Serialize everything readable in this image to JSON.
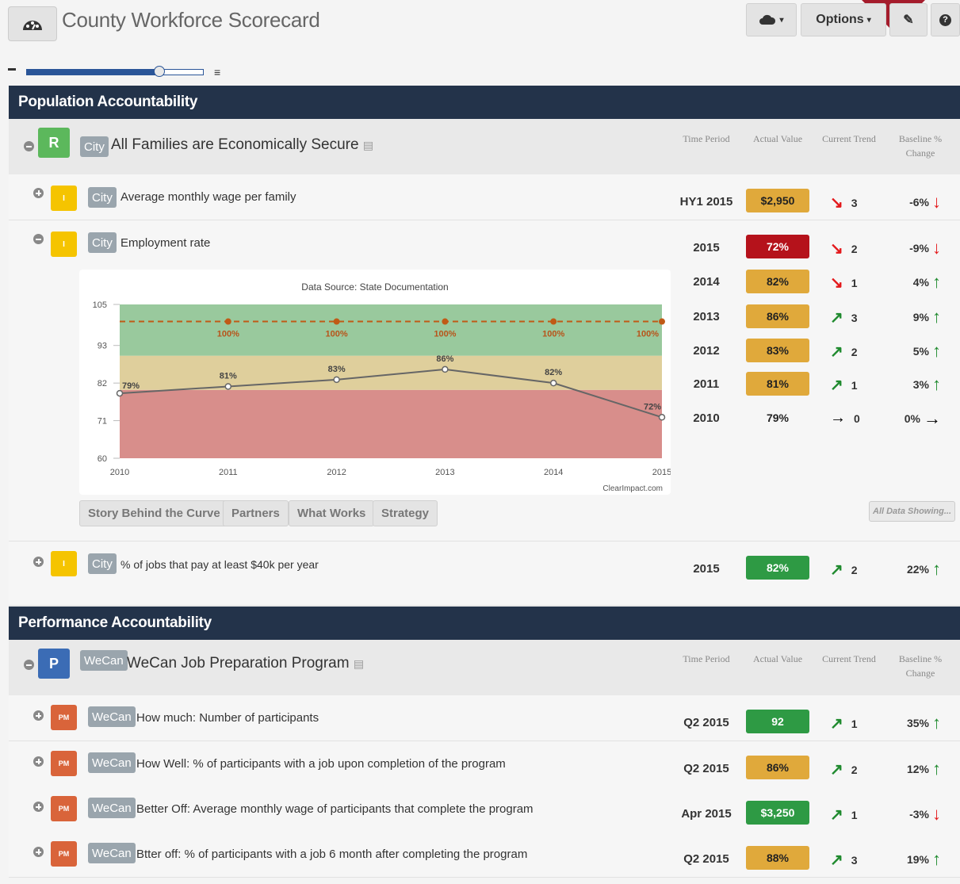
{
  "app": {
    "title": "County Workforce Scorecard",
    "options_label": "Options"
  },
  "sections": [
    {
      "title": "Population Accountability"
    },
    {
      "title": "Performance Accountability"
    }
  ],
  "columns": {
    "time": "Time Period",
    "actual": "Actual Value",
    "trend": "Current Trend",
    "baseline": "Baseline % Change"
  },
  "group1": {
    "badge": "R",
    "scope": "City",
    "title": "All Families are Economically Secure",
    "badge_color": "#5cb85c"
  },
  "rows1": [
    {
      "badge": "I",
      "scope": "City",
      "title": "Average monthly wage per family",
      "period": "HY1 2015",
      "value": "$2,950",
      "trend": "3",
      "baseline": "-6%"
    },
    {
      "badge": "I",
      "scope": "City",
      "title": "Employment rate",
      "period": "2015",
      "value": "72%",
      "trend": "2",
      "baseline": "-9%"
    },
    {
      "badge": "I",
      "scope": "City",
      "title": "% of jobs that pay at least $40k per year",
      "period": "2015",
      "value": "82%",
      "trend": "2",
      "baseline": "22%"
    }
  ],
  "history": [
    {
      "period": "2014",
      "value": "82%",
      "trend": "1",
      "baseline": "4%"
    },
    {
      "period": "2013",
      "value": "86%",
      "trend": "3",
      "baseline": "9%"
    },
    {
      "period": "2012",
      "value": "83%",
      "trend": "2",
      "baseline": "5%"
    },
    {
      "period": "2011",
      "value": "81%",
      "trend": "1",
      "baseline": "3%"
    },
    {
      "period": "2010",
      "value": "79%",
      "trend": "0",
      "baseline": "0%"
    }
  ],
  "chart_tabs": [
    "Story Behind the Curve",
    "Partners",
    "What Works",
    "Strategy"
  ],
  "all_data_label": "All Data Showing...",
  "chart_data": {
    "type": "line",
    "title": "Data Source: State Documentation",
    "credit": "ClearImpact.com",
    "x": [
      "2010",
      "2011",
      "2012",
      "2013",
      "2014",
      "2015"
    ],
    "series": [
      {
        "name": "",
        "values": [
          79,
          81,
          83,
          86,
          82,
          72
        ],
        "labels": [
          "79%",
          "81%",
          "83%",
          "86%",
          "82%",
          "72%"
        ]
      },
      {
        "name": "",
        "values": [
          null,
          100,
          100,
          100,
          100,
          100
        ],
        "labels": [
          "",
          "100%",
          "100%",
          "100%",
          "100%",
          "100%"
        ]
      }
    ],
    "yticks": [
      "105",
      "93",
      "82",
      "71",
      "60"
    ],
    "ylim": [
      60,
      105
    ],
    "bands": [
      {
        "from": 60,
        "to": 80,
        "color": "#d88e8b"
      },
      {
        "from": 80,
        "to": 90,
        "color": "#dfcf9c"
      },
      {
        "from": 90,
        "to": 105,
        "color": "#99c99d"
      }
    ],
    "grid": false
  },
  "group2": {
    "badge": "P",
    "scope": "WeCan",
    "title": "WeCan Job Preparation Program",
    "badge_color": "#3b6cb5"
  },
  "rows2": [
    {
      "badge": "PM",
      "scope": "WeCan",
      "title": "How much: Number of participants",
      "period": "Q2 2015",
      "value": "92",
      "trend": "1",
      "baseline": "35%"
    },
    {
      "badge": "PM",
      "scope": "WeCan",
      "title": "How Well: % of participants with a job upon completion of the program",
      "period": "Q2 2015",
      "value": "86%",
      "trend": "2",
      "baseline": "12%"
    },
    {
      "badge": "PM",
      "scope": "WeCan",
      "title": "Better Off: Average monthly wage of participants that complete the program",
      "period": "Apr 2015",
      "value": "$3,250",
      "trend": "1",
      "baseline": "-3%"
    },
    {
      "badge": "PM",
      "scope": "WeCan",
      "title": "Btter off: % of participants with a job 6 month after completing the program",
      "period": "Q2 2015",
      "value": "88%",
      "trend": "3",
      "baseline": "19%"
    }
  ],
  "colors": {
    "red": "#b5121b",
    "amber": "#e0a93b",
    "green": "#2e9a44",
    "trend_green": "#1f8a2e",
    "trend_red": "#e3181b"
  }
}
